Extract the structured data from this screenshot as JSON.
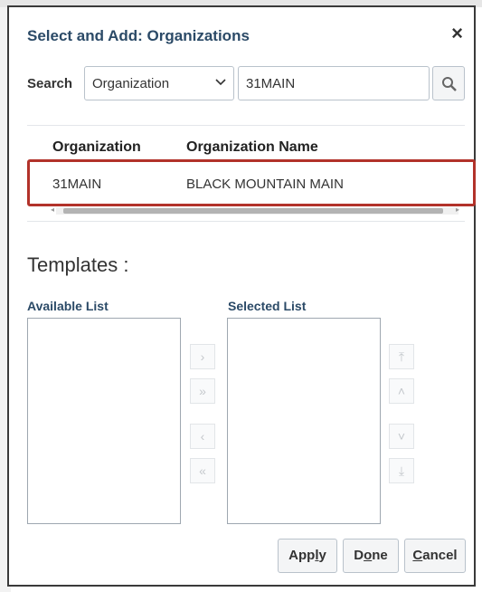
{
  "dialog": {
    "title": "Select and Add: Organizations",
    "close_symbol": "×"
  },
  "search": {
    "label": "Search",
    "field_selected": "Organization",
    "value": "31MAIN",
    "dropdown_icon": "chevron-down-icon",
    "button_icon": "search-icon"
  },
  "table": {
    "columns": [
      "Organization",
      "Organization Name"
    ],
    "rows": [
      {
        "organization": "31MAIN",
        "organization_name": "BLACK MOUNTAIN MAIN",
        "highlighted": true
      }
    ]
  },
  "templates": {
    "heading": "Templates :",
    "available_label": "Available List",
    "selected_label": "Selected List",
    "available_items": [],
    "selected_items": []
  },
  "shuttle": {
    "move": "›",
    "move_all": "»",
    "remove": "‹",
    "remove_all": "«"
  },
  "reorder": {
    "top": "⤒",
    "up": "˄",
    "down": "˅",
    "bottom": "⤓"
  },
  "buttons": {
    "apply": {
      "pre": "App",
      "mnemonic": "l",
      "post": "y"
    },
    "done": {
      "pre": "D",
      "mnemonic": "o",
      "post": "ne"
    },
    "cancel": {
      "pre": "",
      "mnemonic": "C",
      "post": "ancel"
    }
  },
  "colors": {
    "title": "#2b4a67",
    "highlight_border": "#b2322a"
  }
}
